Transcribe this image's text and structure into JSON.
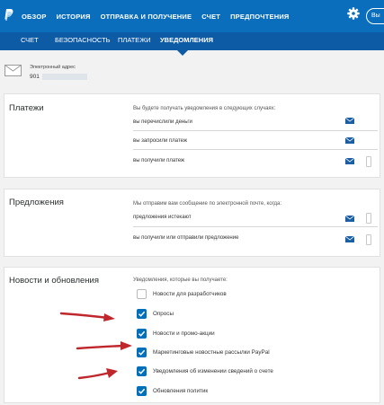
{
  "topnav": {
    "items": [
      "ОБЗОР",
      "ИСТОРИЯ",
      "ОТПРАВКА И ПОЛУЧЕНИЕ",
      "СЧЕТ",
      "ПРЕДПОЧТЕНИЯ"
    ],
    "exit_label": "Вы"
  },
  "subnav": {
    "items": [
      "СЧЕТ",
      "БЕЗОПАСНОСТЬ",
      "ПЛАТЕЖИ",
      "УВЕДОМЛЕНИЯ"
    ],
    "active": "УВЕДОМЛЕНИЯ"
  },
  "email": {
    "label": "Электронный адрес",
    "value": "901"
  },
  "payments": {
    "title": "Платежи",
    "intro": "Вы будете получать уведомления в следующих случаях:",
    "rows": [
      "вы перечислили деньги",
      "вы запросили платеж",
      "вы получили платеж"
    ]
  },
  "offers": {
    "title": "Предложения",
    "intro": "Мы отправим вам сообщение по электронной почте, когда:",
    "rows": [
      "предложения истекают",
      "вы получили или отправили предложение"
    ]
  },
  "news": {
    "title": "Новости и обновления",
    "intro": "Уведомления, которые вы получаете:",
    "items": [
      {
        "label": "Новости для разработчиков",
        "checked": false
      },
      {
        "label": "Опросы",
        "checked": true
      },
      {
        "label": "Новости и промо-акции",
        "checked": true
      },
      {
        "label": "Маркетинговые новостные рассылки PayPal",
        "checked": true
      },
      {
        "label": "Уведомления об изменении сведений о счете",
        "checked": true
      },
      {
        "label": "Обновления политик",
        "checked": true
      }
    ]
  },
  "colors": {
    "topbar": "#0a6ebd",
    "subbar": "#0d5aa5",
    "checkbox": "#0070ba",
    "arrow": "#c0272d"
  }
}
